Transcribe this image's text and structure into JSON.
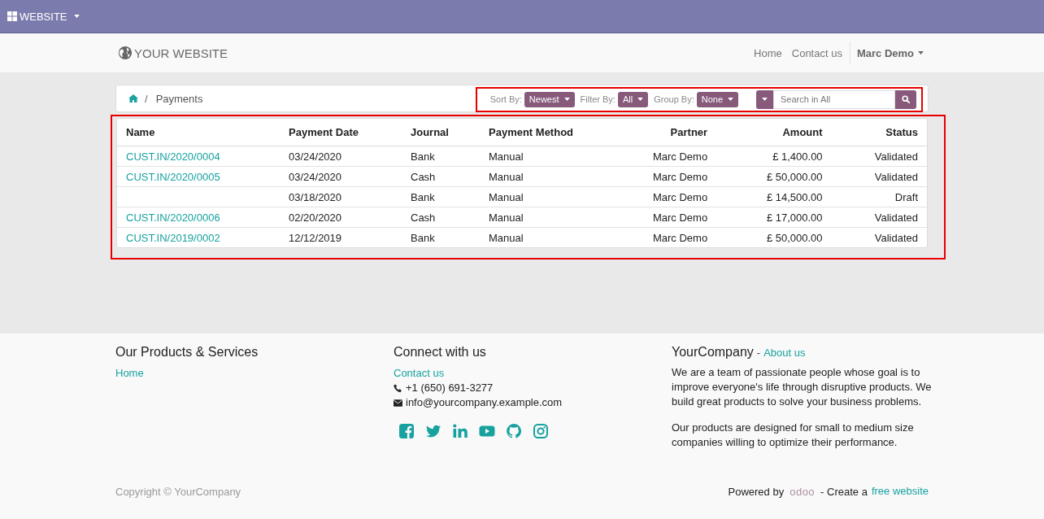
{
  "admin_bar": {
    "app_menu": "WEBSITE"
  },
  "header": {
    "logo": "YOUR WEBSITE",
    "nav": [
      "Home",
      "Contact us"
    ],
    "user": "Marc Demo"
  },
  "breadcrumb": {
    "separator": "/",
    "items": [
      "Payments"
    ]
  },
  "toolbar": {
    "highlighted": true,
    "controls": [
      {
        "label": "Sort By:",
        "value": "Newest"
      },
      {
        "label": "Filter By:",
        "value": "All"
      },
      {
        "label": "Group By:",
        "value": "None"
      }
    ],
    "search": {
      "placeholder": "Search in All"
    }
  },
  "table": {
    "highlighted": true,
    "columns": [
      {
        "label": "Name",
        "numeric": false
      },
      {
        "label": "Payment Date",
        "numeric": false
      },
      {
        "label": "Journal",
        "numeric": false
      },
      {
        "label": "Payment Method",
        "numeric": false
      },
      {
        "label": "Partner",
        "numeric": true
      },
      {
        "label": "Amount",
        "numeric": true
      },
      {
        "label": "Status",
        "numeric": true
      }
    ],
    "rows": [
      [
        "CUST.IN/2020/0004",
        "03/24/2020",
        "Bank",
        "Manual",
        "Marc Demo",
        "£ 1,400.00",
        "Validated"
      ],
      [
        "CUST.IN/2020/0005",
        "03/24/2020",
        "Cash",
        "Manual",
        "Marc Demo",
        "£ 50,000.00",
        "Validated"
      ],
      [
        "",
        "03/18/2020",
        "Bank",
        "Manual",
        "Marc Demo",
        "£ 14,500.00",
        "Draft"
      ],
      [
        "CUST.IN/2020/0006",
        "02/20/2020",
        "Cash",
        "Manual",
        "Marc Demo",
        "£ 17,000.00",
        "Validated"
      ],
      [
        "CUST.IN/2019/0002",
        "12/12/2019",
        "Bank",
        "Manual",
        "Marc Demo",
        "£ 50,000.00",
        "Validated"
      ]
    ]
  },
  "footer": {
    "products": {
      "title": "Our Products & Services",
      "links": [
        "Home"
      ]
    },
    "connect": {
      "title": "Connect with us",
      "link": "Contact us",
      "phone": "+1 (650) 691-3277",
      "email": "info@yourcompany.example.com",
      "social": [
        {
          "kind": "facebook"
        },
        {
          "kind": "twitter"
        },
        {
          "kind": "linkedin"
        },
        {
          "kind": "youtube"
        },
        {
          "kind": "github"
        },
        {
          "kind": "instagram"
        }
      ]
    },
    "about": {
      "title": "YourCompany",
      "separator": "-",
      "link": "About us",
      "paragraphs": [
        "We are a team of passionate people whose goal is to improve everyone's life through disruptive products. We build great products to solve your business problems.",
        "Our products are designed for small to medium size companies willing to optimize their performance."
      ]
    },
    "copyright": "Copyright © YourCompany",
    "powered": {
      "prefix": "Powered by",
      "brand": "odoo",
      "middle": "- Create a",
      "link": "free website"
    }
  }
}
